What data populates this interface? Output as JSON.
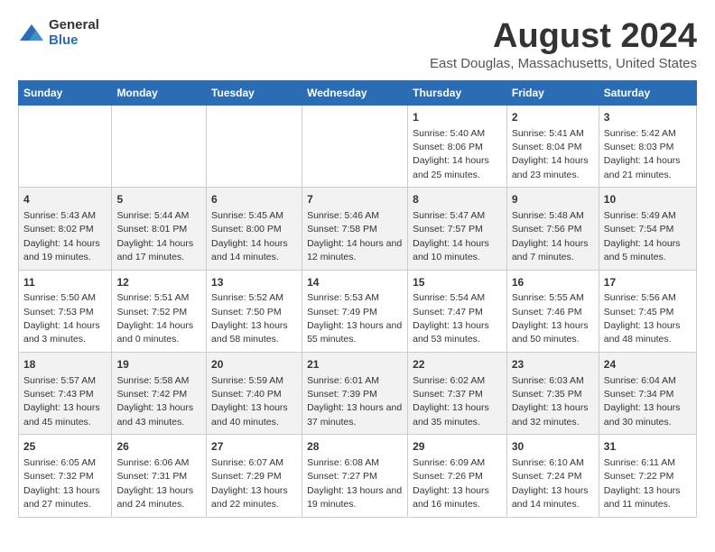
{
  "logo": {
    "general": "General",
    "blue": "Blue"
  },
  "title": "August 2024",
  "subtitle": "East Douglas, Massachusetts, United States",
  "days_of_week": [
    "Sunday",
    "Monday",
    "Tuesday",
    "Wednesday",
    "Thursday",
    "Friday",
    "Saturday"
  ],
  "weeks": [
    [
      {
        "day": "",
        "info": ""
      },
      {
        "day": "",
        "info": ""
      },
      {
        "day": "",
        "info": ""
      },
      {
        "day": "",
        "info": ""
      },
      {
        "day": "1",
        "info": "Sunrise: 5:40 AM\nSunset: 8:06 PM\nDaylight: 14 hours and 25 minutes."
      },
      {
        "day": "2",
        "info": "Sunrise: 5:41 AM\nSunset: 8:04 PM\nDaylight: 14 hours and 23 minutes."
      },
      {
        "day": "3",
        "info": "Sunrise: 5:42 AM\nSunset: 8:03 PM\nDaylight: 14 hours and 21 minutes."
      }
    ],
    [
      {
        "day": "4",
        "info": "Sunrise: 5:43 AM\nSunset: 8:02 PM\nDaylight: 14 hours and 19 minutes."
      },
      {
        "day": "5",
        "info": "Sunrise: 5:44 AM\nSunset: 8:01 PM\nDaylight: 14 hours and 17 minutes."
      },
      {
        "day": "6",
        "info": "Sunrise: 5:45 AM\nSunset: 8:00 PM\nDaylight: 14 hours and 14 minutes."
      },
      {
        "day": "7",
        "info": "Sunrise: 5:46 AM\nSunset: 7:58 PM\nDaylight: 14 hours and 12 minutes."
      },
      {
        "day": "8",
        "info": "Sunrise: 5:47 AM\nSunset: 7:57 PM\nDaylight: 14 hours and 10 minutes."
      },
      {
        "day": "9",
        "info": "Sunrise: 5:48 AM\nSunset: 7:56 PM\nDaylight: 14 hours and 7 minutes."
      },
      {
        "day": "10",
        "info": "Sunrise: 5:49 AM\nSunset: 7:54 PM\nDaylight: 14 hours and 5 minutes."
      }
    ],
    [
      {
        "day": "11",
        "info": "Sunrise: 5:50 AM\nSunset: 7:53 PM\nDaylight: 14 hours and 3 minutes."
      },
      {
        "day": "12",
        "info": "Sunrise: 5:51 AM\nSunset: 7:52 PM\nDaylight: 14 hours and 0 minutes."
      },
      {
        "day": "13",
        "info": "Sunrise: 5:52 AM\nSunset: 7:50 PM\nDaylight: 13 hours and 58 minutes."
      },
      {
        "day": "14",
        "info": "Sunrise: 5:53 AM\nSunset: 7:49 PM\nDaylight: 13 hours and 55 minutes."
      },
      {
        "day": "15",
        "info": "Sunrise: 5:54 AM\nSunset: 7:47 PM\nDaylight: 13 hours and 53 minutes."
      },
      {
        "day": "16",
        "info": "Sunrise: 5:55 AM\nSunset: 7:46 PM\nDaylight: 13 hours and 50 minutes."
      },
      {
        "day": "17",
        "info": "Sunrise: 5:56 AM\nSunset: 7:45 PM\nDaylight: 13 hours and 48 minutes."
      }
    ],
    [
      {
        "day": "18",
        "info": "Sunrise: 5:57 AM\nSunset: 7:43 PM\nDaylight: 13 hours and 45 minutes."
      },
      {
        "day": "19",
        "info": "Sunrise: 5:58 AM\nSunset: 7:42 PM\nDaylight: 13 hours and 43 minutes."
      },
      {
        "day": "20",
        "info": "Sunrise: 5:59 AM\nSunset: 7:40 PM\nDaylight: 13 hours and 40 minutes."
      },
      {
        "day": "21",
        "info": "Sunrise: 6:01 AM\nSunset: 7:39 PM\nDaylight: 13 hours and 37 minutes."
      },
      {
        "day": "22",
        "info": "Sunrise: 6:02 AM\nSunset: 7:37 PM\nDaylight: 13 hours and 35 minutes."
      },
      {
        "day": "23",
        "info": "Sunrise: 6:03 AM\nSunset: 7:35 PM\nDaylight: 13 hours and 32 minutes."
      },
      {
        "day": "24",
        "info": "Sunrise: 6:04 AM\nSunset: 7:34 PM\nDaylight: 13 hours and 30 minutes."
      }
    ],
    [
      {
        "day": "25",
        "info": "Sunrise: 6:05 AM\nSunset: 7:32 PM\nDaylight: 13 hours and 27 minutes."
      },
      {
        "day": "26",
        "info": "Sunrise: 6:06 AM\nSunset: 7:31 PM\nDaylight: 13 hours and 24 minutes."
      },
      {
        "day": "27",
        "info": "Sunrise: 6:07 AM\nSunset: 7:29 PM\nDaylight: 13 hours and 22 minutes."
      },
      {
        "day": "28",
        "info": "Sunrise: 6:08 AM\nSunset: 7:27 PM\nDaylight: 13 hours and 19 minutes."
      },
      {
        "day": "29",
        "info": "Sunrise: 6:09 AM\nSunset: 7:26 PM\nDaylight: 13 hours and 16 minutes."
      },
      {
        "day": "30",
        "info": "Sunrise: 6:10 AM\nSunset: 7:24 PM\nDaylight: 13 hours and 14 minutes."
      },
      {
        "day": "31",
        "info": "Sunrise: 6:11 AM\nSunset: 7:22 PM\nDaylight: 13 hours and 11 minutes."
      }
    ]
  ]
}
